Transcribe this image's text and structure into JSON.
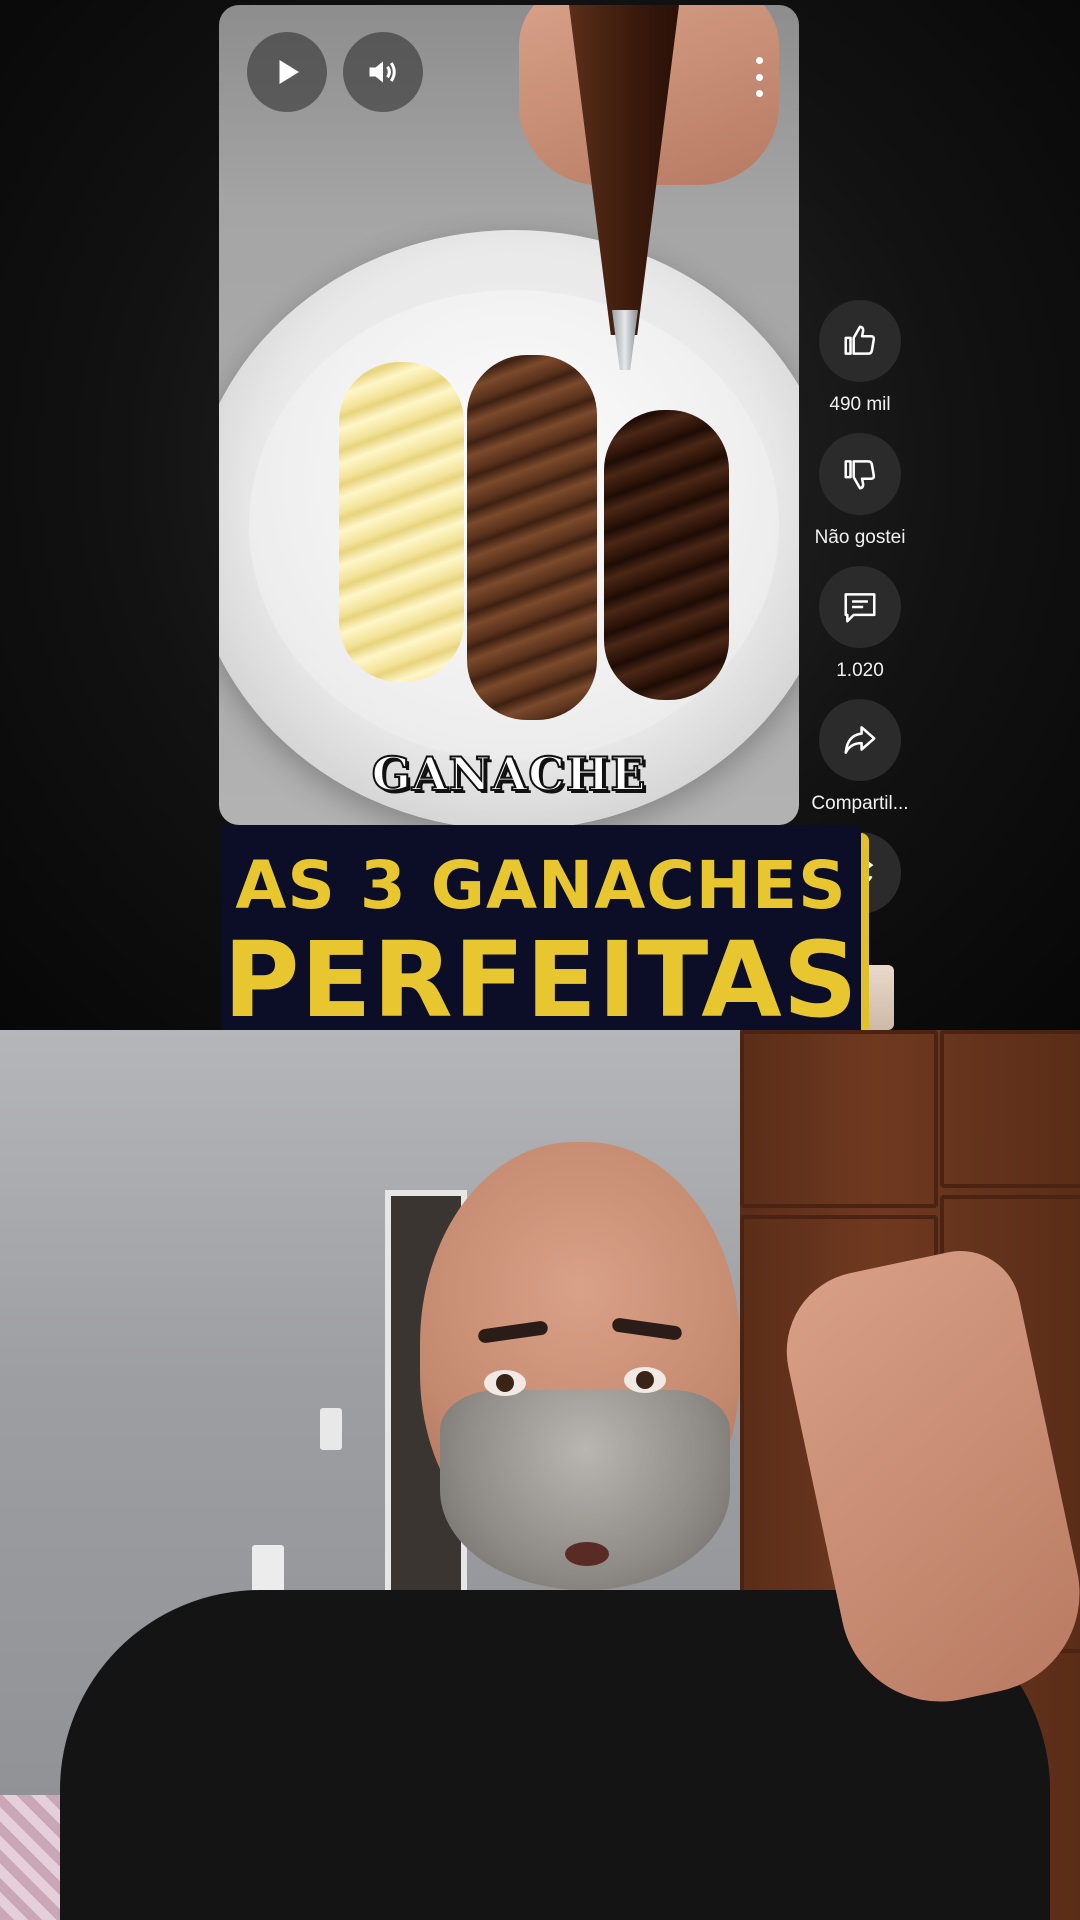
{
  "video": {
    "overlay_word": "GANACHE",
    "controls": {
      "play": "play-icon",
      "volume": "volume-icon",
      "menu": "more-vert-icon"
    }
  },
  "actions": {
    "like": {
      "icon": "thumbs-up-icon",
      "label": "490 mil"
    },
    "dislike": {
      "icon": "thumbs-down-icon",
      "label": "Não gostei"
    },
    "comments": {
      "icon": "comment-icon",
      "label": "1.020"
    },
    "share": {
      "icon": "share-icon",
      "label": "Compartil..."
    },
    "remix": {
      "icon": "remix-icon"
    }
  },
  "title": {
    "line1": "AS 3 GANACHES",
    "line2": "PERFEITAS"
  },
  "colors": {
    "banner_bg": "#0b0e26",
    "banner_text": "#e7c62f",
    "banner_shadow": "#e0c12d"
  }
}
